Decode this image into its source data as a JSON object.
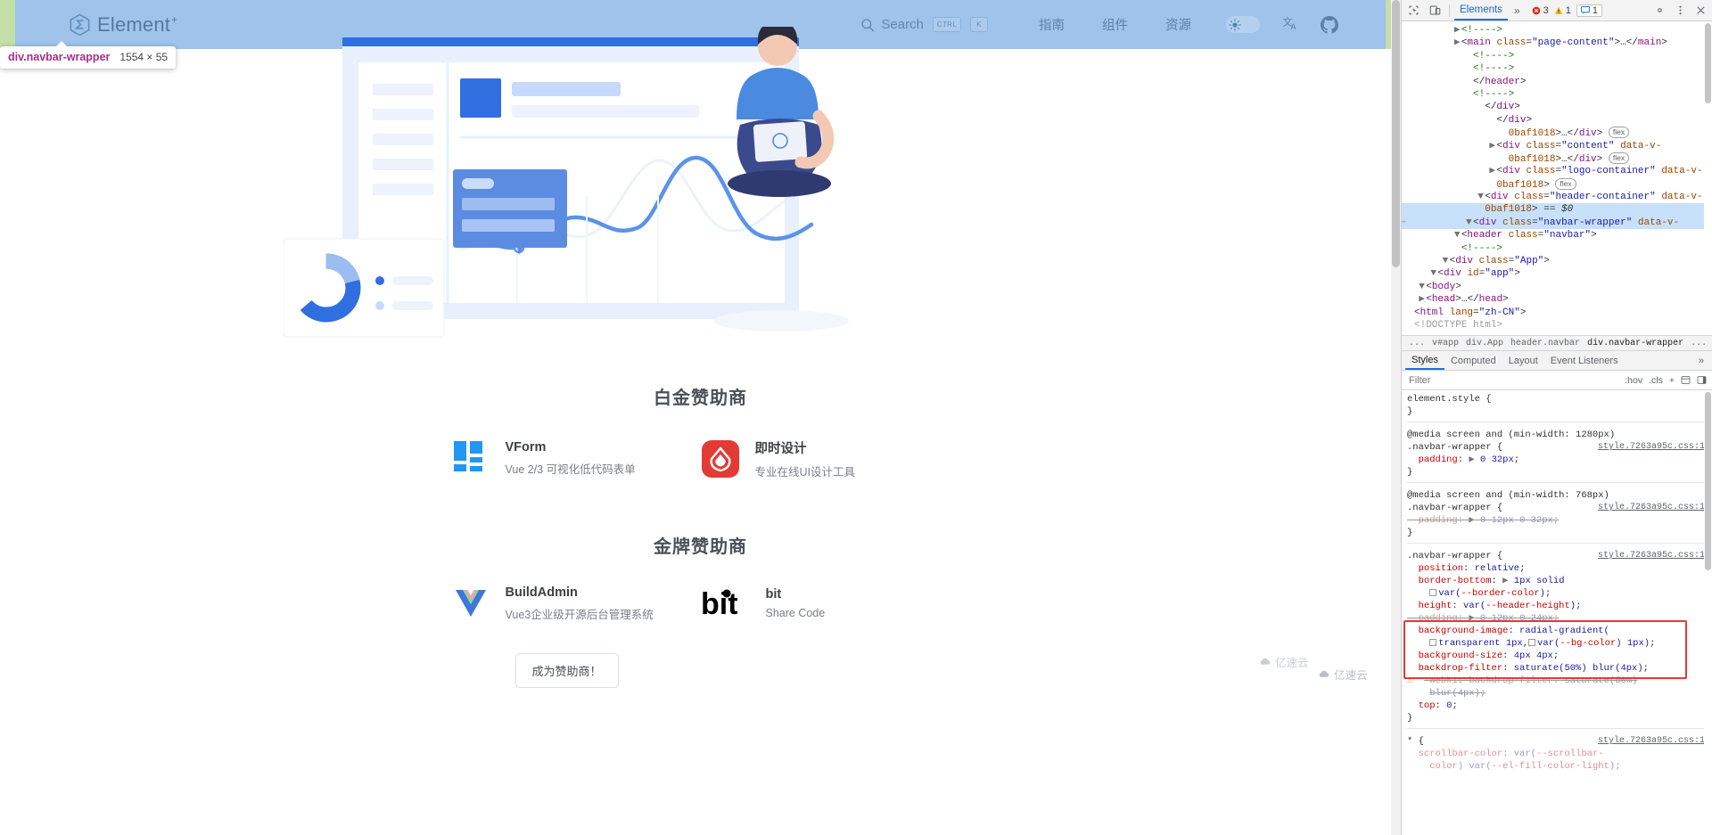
{
  "page": {
    "navbar": {
      "logo_text": "Element",
      "logo_plus": "+",
      "search_placeholder": "Search",
      "kbd_ctrl": "CTRL",
      "kbd_key": "K",
      "links": [
        {
          "label": "指南"
        },
        {
          "label": "组件"
        },
        {
          "label": "资源"
        }
      ],
      "theme_icon": "sun-icon",
      "translate_icon": "translate-icon",
      "github_icon": "github-icon"
    },
    "inspect_tooltip": {
      "selector": "div.navbar-wrapper",
      "dimensions": "1554 × 55"
    },
    "sections": [
      {
        "title": "白金赞助商",
        "sponsors": [
          {
            "name": "VForm",
            "desc": "Vue 2/3 可视化低代码表单",
            "logo": "vform-logo"
          },
          {
            "name": "即时设计",
            "desc": "专业在线UI设计工具",
            "logo": "jsdesign-logo"
          }
        ]
      },
      {
        "title": "金牌赞助商",
        "sponsors": [
          {
            "name": "BuildAdmin",
            "desc": "Vue3企业级开源后台管理系统",
            "logo": "buildadmin-logo"
          },
          {
            "name": "bit",
            "desc": "Share Code",
            "logo": "bit-logo"
          }
        ]
      }
    ],
    "become_sponsor_button": "成为赞助商！",
    "watermarks": [
      {
        "text": "亿速云"
      },
      {
        "text": "亿速云"
      }
    ]
  },
  "devtools": {
    "toolbar": {
      "inspect_icon": "inspect-cursor-icon",
      "device_icon": "device-toolbar-icon",
      "active_tab": "Elements",
      "more_tabs": "»",
      "errors": "3",
      "warnings": "1",
      "messages": "1",
      "settings_icon": "gear-icon",
      "kebab_icon": "more-vertical-icon",
      "close_icon": "close-icon"
    },
    "dom_lines": [
      {
        "indent": 0,
        "tri": "",
        "html": "<span class='tk-doctype'>&lt;!DOCTYPE html&gt;</span>"
      },
      {
        "indent": 0,
        "tri": "",
        "html": "<span class='tk-punc'>&lt;</span><span class='tk-tag'>html</span> <span class='tk-attr'>lang</span>=<span class='tk-val'>\"zh-CN\"</span><span class='tk-punc'>&gt;</span>"
      },
      {
        "indent": 1,
        "tri": "▶",
        "html": "<span class='tk-punc'>&lt;</span><span class='tk-tag'>head</span><span class='tk-punc'>&gt;</span>…<span class='tk-punc'>&lt;/</span><span class='tk-tag'>head</span><span class='tk-punc'>&gt;</span>"
      },
      {
        "indent": 1,
        "tri": "▼",
        "html": "<span class='tk-punc'>&lt;</span><span class='tk-tag'>body</span><span class='tk-punc'>&gt;</span>"
      },
      {
        "indent": 2,
        "tri": "▼",
        "html": "<span class='tk-punc'>&lt;</span><span class='tk-tag'>div</span> <span class='tk-attr'>id</span>=<span class='tk-val'>\"app\"</span><span class='tk-punc'>&gt;</span>"
      },
      {
        "indent": 3,
        "tri": "▼",
        "html": "<span class='tk-punc'>&lt;</span><span class='tk-tag'>div</span> <span class='tk-attr'>class</span>=<span class='tk-val'>\"App\"</span><span class='tk-punc'>&gt;</span>"
      },
      {
        "indent": 4,
        "tri": "",
        "html": "<span class='tk-com'>&lt;!----&gt;</span>"
      },
      {
        "indent": 4,
        "tri": "▼",
        "html": "<span class='tk-punc'>&lt;</span><span class='tk-tag'>header</span> <span class='tk-attr'>class</span>=<span class='tk-val'>\"navbar\"</span><span class='tk-punc'>&gt;</span>"
      },
      {
        "indent": 5,
        "tri": "▼",
        "sel": true,
        "dots": true,
        "html": "<span class='tk-punc'>&lt;</span><span class='tk-tag'>div</span> <span class='tk-attr'>class</span>=<span class='tk-val'>\"navbar-wrapper\"</span> <span class='tk-attr'>data-v-</span>"
      },
      {
        "indent": 6,
        "tri": "",
        "sel": true,
        "html": "<span class='tk-attr'>0baf1018</span><span class='tk-punc'>&gt;</span> == <span class='tk-ref'>$0</span>"
      },
      {
        "indent": 6,
        "tri": "▼",
        "html": "<span class='tk-punc'>&lt;</span><span class='tk-tag'>div</span> <span class='tk-attr'>class</span>=<span class='tk-val'>\"header-container\"</span> <span class='tk-attr'>data-v-</span>"
      },
      {
        "indent": 7,
        "tri": "",
        "html": "<span class='tk-attr'>0baf1018</span><span class='tk-punc'>&gt;</span> <span class='tk-flex'>flex</span>"
      },
      {
        "indent": 7,
        "tri": "▶",
        "html": "<span class='tk-punc'>&lt;</span><span class='tk-tag'>div</span> <span class='tk-attr'>class</span>=<span class='tk-val'>\"logo-container\"</span> <span class='tk-attr'>data-v-</span>"
      },
      {
        "indent": 8,
        "tri": "",
        "html": "<span class='tk-attr'>0baf1018</span><span class='tk-punc'>&gt;</span>…<span class='tk-punc'>&lt;/</span><span class='tk-tag'>div</span><span class='tk-punc'>&gt;</span> <span class='tk-flex'>flex</span>"
      },
      {
        "indent": 7,
        "tri": "▶",
        "html": "<span class='tk-punc'>&lt;</span><span class='tk-tag'>div</span> <span class='tk-attr'>class</span>=<span class='tk-val'>\"content\"</span> <span class='tk-attr'>data-v-</span>"
      },
      {
        "indent": 8,
        "tri": "",
        "html": "<span class='tk-attr'>0baf1018</span><span class='tk-punc'>&gt;</span>…<span class='tk-punc'>&lt;/</span><span class='tk-tag'>div</span><span class='tk-punc'>&gt;</span> <span class='tk-flex'>flex</span>"
      },
      {
        "indent": 7,
        "tri": "",
        "html": "<span class='tk-punc'>&lt;/</span><span class='tk-tag'>div</span><span class='tk-punc'>&gt;</span>"
      },
      {
        "indent": 6,
        "tri": "",
        "html": "<span class='tk-punc'>&lt;/</span><span class='tk-tag'>div</span><span class='tk-punc'>&gt;</span>"
      },
      {
        "indent": 5,
        "tri": "",
        "html": "<span class='tk-com'>&lt;!----&gt;</span>"
      },
      {
        "indent": 5,
        "tri": "",
        "html": "<span class='tk-punc'>&lt;/</span><span class='tk-tag'>header</span><span class='tk-punc'>&gt;</span>"
      },
      {
        "indent": 5,
        "tri": "",
        "html": "<span class='tk-com'>&lt;!----&gt;</span>"
      },
      {
        "indent": 5,
        "tri": "",
        "html": "<span class='tk-com'>&lt;!----&gt;</span>"
      },
      {
        "indent": 4,
        "tri": "▶",
        "html": "<span class='tk-punc'>&lt;</span><span class='tk-tag'>main</span> <span class='tk-attr'>class</span>=<span class='tk-val'>\"page-content\"</span><span class='tk-punc'>&gt;</span>…<span class='tk-punc'>&lt;/</span><span class='tk-tag'>main</span><span class='tk-punc'>&gt;</span>"
      },
      {
        "indent": 4,
        "tri": "▶",
        "html": "<span class='tk-com'>&lt;!----&gt;</span>"
      }
    ],
    "breadcrumb": [
      "...",
      "v#app",
      "div.App",
      "header.navbar",
      "div.navbar-wrapper",
      "..."
    ],
    "panel_tabs": [
      {
        "label": "Styles",
        "active": true
      },
      {
        "label": "Computed",
        "active": false
      },
      {
        "label": "Layout",
        "active": false
      },
      {
        "label": "Event Listeners",
        "active": false
      }
    ],
    "panel_more": "»",
    "filter": {
      "placeholder": "Filter",
      "hov": ":hov",
      "cls": ".cls",
      "plus": "+"
    },
    "styles_lines": [
      {
        "t": "sel",
        "html": "element.style {"
      },
      {
        "t": "plain",
        "html": "}"
      },
      {
        "t": "gap"
      },
      {
        "t": "media",
        "html": "@media screen and (min-width: 1280px)"
      },
      {
        "t": "sel",
        "html": ".navbar-wrapper {",
        "src": "style.7263a95c.css:1"
      },
      {
        "t": "decl",
        "html": "&nbsp;&nbsp;<span class='st-prop'>padding</span>: <span class='st-arrow'>▶</span> <span class='st-val'>0 32px</span>;"
      },
      {
        "t": "plain",
        "html": "}"
      },
      {
        "t": "gap"
      },
      {
        "t": "media",
        "html": "@media screen and (min-width: 768px)"
      },
      {
        "t": "sel",
        "html": ".navbar-wrapper {",
        "src": "style.7263a95c.css:1"
      },
      {
        "t": "strike",
        "html": "&nbsp;&nbsp;<span class='st-prop'>padding</span>: <span class='st-arrow'>▶</span> <span class='st-val'>0 12px 0 32px</span>;"
      },
      {
        "t": "plain",
        "html": "}"
      },
      {
        "t": "gap"
      },
      {
        "t": "sel",
        "html": ".navbar-wrapper {",
        "src": "style.7263a95c.css:1"
      },
      {
        "t": "decl",
        "html": "&nbsp;&nbsp;<span class='st-prop'>position</span>: <span class='st-val'>relative</span>;"
      },
      {
        "t": "decl",
        "html": "&nbsp;&nbsp;<span class='st-prop'>border-bottom</span>: <span class='st-arrow'>▶</span> <span class='st-val'>1px solid</span>"
      },
      {
        "t": "decl",
        "html": "&nbsp;&nbsp;&nbsp;&nbsp;<span class='swatch'></span><span class='st-val'>var(</span><span class='st-prop'>--border-color</span><span class='st-val'>)</span>;"
      },
      {
        "t": "decl",
        "html": "&nbsp;&nbsp;<span class='st-prop'>height</span>: <span class='st-val'>var(</span><span class='st-prop'>--header-height</span><span class='st-val'>)</span>;"
      },
      {
        "t": "strike",
        "html": "&nbsp;&nbsp;<span class='st-prop'>padding</span>: <span class='st-arrow'>▶</span> <span class='st-val'>0 12px 0 24px</span>;"
      },
      {
        "t": "decl",
        "html": "&nbsp;&nbsp;<span class='st-prop'>background-image</span>: <span class='st-val'>radial-gradient(</span>"
      },
      {
        "t": "decl",
        "html": "&nbsp;&nbsp;&nbsp;&nbsp;<span class='swatch'></span><span class='st-val'>transparent 1px,</span><span class='swatch'></span><span class='st-val'>var(</span><span class='st-prop'>--bg-color</span><span class='st-val'>) 1px)</span>;"
      },
      {
        "t": "decl",
        "html": "&nbsp;&nbsp;<span class='st-prop'>background-size</span>: <span class='st-val'>4px 4px</span>;"
      },
      {
        "t": "decl",
        "html": "&nbsp;&nbsp;<span class='st-prop'>backdrop-filter</span>: <span class='st-val'>saturate(50%) blur(4px)</span>;"
      },
      {
        "t": "warn",
        "html": "&nbsp;&nbsp;<span class='st-strike'><span class='st-prop'>-webkit-backdrop-filter</span>: <span class='st-val'>saturate(50%)</span></span>"
      },
      {
        "t": "warnc",
        "html": "&nbsp;&nbsp;&nbsp;&nbsp;<span class='st-strike'><span class='st-val'>blur(4px)</span>;</span>"
      },
      {
        "t": "decl",
        "html": "&nbsp;&nbsp;<span class='st-prop'>top</span>: <span class='st-val'>0</span>;"
      },
      {
        "t": "plain",
        "html": "}"
      },
      {
        "t": "gap"
      },
      {
        "t": "sel",
        "html": "* {",
        "src": "style.7263a95c.css:1"
      },
      {
        "t": "fade",
        "html": "&nbsp;&nbsp;<span class='st-prop'>scrollbar-color</span>: <span class='st-val'>var(</span><span class='st-prop'>--scrollbar-</span>"
      },
      {
        "t": "fade",
        "html": "&nbsp;&nbsp;&nbsp;&nbsp;<span class='st-prop'>color</span><span class='st-val'>) var(</span><span class='st-prop'>--el-fill-color-light</span><span class='st-val'>)</span>;"
      }
    ]
  }
}
